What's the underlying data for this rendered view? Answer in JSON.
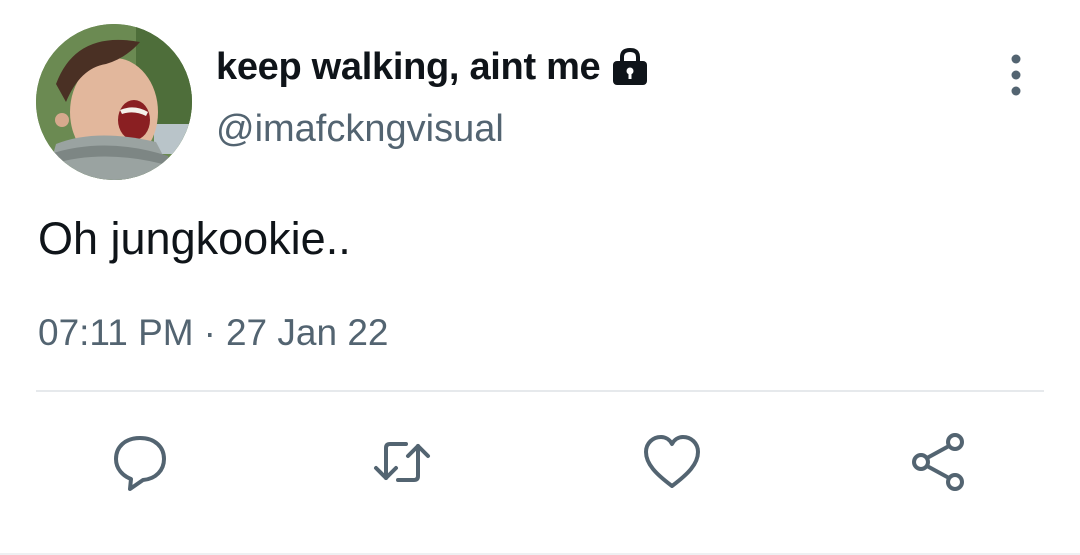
{
  "user": {
    "display_name": "keep walking, aint me",
    "handle": "@imafckngvisual",
    "avatar_icon": "profile-photo",
    "protected_icon": "lock-icon"
  },
  "tweet": {
    "text": "Oh jungkookie..",
    "time": "07:11 PM",
    "separator": "·",
    "date": "27 Jan 22"
  },
  "actions": {
    "reply_icon": "comment-icon",
    "retweet_icon": "retweet-icon",
    "like_icon": "heart-icon",
    "share_icon": "share-icon",
    "more_icon": "more-vertical-icon"
  },
  "colors": {
    "text_primary": "#0f1419",
    "text_secondary": "#536471",
    "icon": "#536471",
    "divider": "#e6e9ec"
  }
}
